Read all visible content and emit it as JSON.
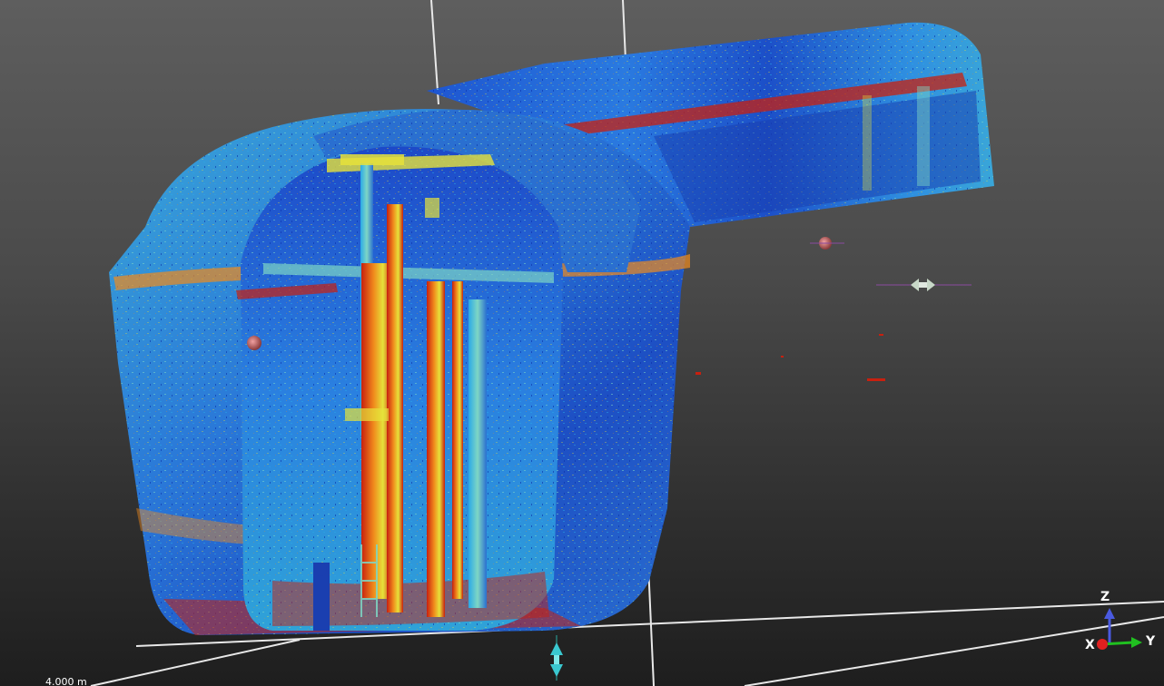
{
  "scene": {
    "background_top": "#5e5e5e",
    "background_bottom": "#1e1e1e",
    "colormap": [
      "#0a2ea8",
      "#1f62e0",
      "#2aa9e8",
      "#7ed6c4",
      "#e6e23a",
      "#f08a1c",
      "#c8200f"
    ],
    "point_picker_marker_color": "#c86a6a",
    "manipulator_icon": "move-arrows-icon"
  },
  "axes_gizmo": {
    "x_label": "X",
    "y_label": "Y",
    "z_label": "Z",
    "x_color": "#e02020",
    "y_color": "#20c020",
    "z_color": "#4a5ae0"
  },
  "scale_bar": {
    "label": "4.000 m"
  }
}
